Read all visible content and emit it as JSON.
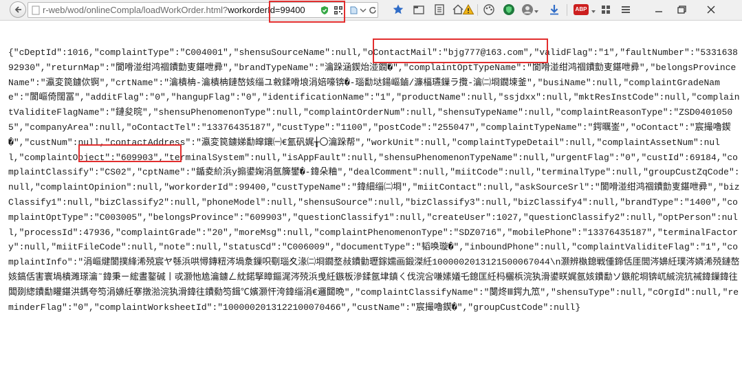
{
  "browser": {
    "url_prefix": "r-web/wod/onlineCompla/loadWorkOrder.html?",
    "url_param": "workorderId=99400",
    "icons": {
      "back": "back-arrow-icon",
      "shield": "shield-check-icon",
      "qr": "qr-code-icon",
      "page": "page-icon",
      "dropdown": "dropdown-arrow-icon",
      "reload": "reload-icon",
      "star": "bookmark-star-icon",
      "tab": "tab-icon",
      "reader": "reading-list-icon",
      "home": "home-icon",
      "alert": "warning-icon",
      "palette": "palette-icon",
      "shield_green": "green-shield-icon",
      "profile": "profile-icon",
      "download": "download-arrow-icon",
      "adblock": "adblock-icon",
      "apps": "apps-grid-icon",
      "menu": "hamburger-menu-icon",
      "minimize": "minimize-icon",
      "restore": "restore-icon",
      "close": "close-icon"
    },
    "adblock_label": "ABP",
    "accent_color": "#e22d2d"
  },
  "json_body": {
    "segments": [
      "{\"cDeptId\":1016,\"complaintType\":\"C004001\",\"shensuSourceName\":null,",
      "\"oContactMail\":\"bjg777@163.com\"",
      ",\"validFlag\":\"1\",\"faultNumber\":\"533163892930\",\"returnMap\":\"閬嗗湴绀鸿祻鐨勯叓鍖呭彛\",\"brandTypeName\":\"瀹跺涵鍥炲湴鐗�\",\"complaintOptTypeName\":\"閬嗗湴绀鸿祻鐨勯叓鍖呭彛\",\"belongsProvinceName\":\"瀛変笢鐪佽锕\",\"crtName\":\"瀹樻柟-瀹樻柟鏈嶅姟缁ユ敹鍒嗗埌涓婄嚎锛�-瑙勫垯鍚嶇鏀/濂楅瓙鏁ラ攬-瀹㈡埛鐗堜釜\",\"busiName\":null,\"complaintGradeName\":\"閬嶇倚闊冨\",\"additFlag\":\"0\",\"hangupFlag\":\"0\",\"identificationName\":\"1\",\"productName\":null,\"ssjdxx\":null,\"mktResInstCode\":null,\"complaintValiditeFlagName\":\"鏈夋晥\",\"shensuPhenomenonType\":null,\"complaintOrderNum\":null,\"shensuTypeName\":null,\"complaintReasonType\":\"ZSD04010505\",\"companyArea\":null,\"oContactTel",
      "\":\"13376435187\",",
      "\"custType\":\"1100\",\"postCode\":\"255047\",\"complaintTypeName\":\"鍔曞崟\",\"oContact\":\"宸撮嚕鍥�\",\"custNum\":null,\"contactAddress\":\"瀛変笢鐪娣勫皡鑲㈠€氳矾娓╁〇瀹跺帮\",\"workUnit\":null,\"complaintTypeDetail\":null,\"complaintAssetNum\":null,\"complaintObject\":\"609903\",\"terminalSystem\":null,\"isAppFault\":null,\"shensuPhenomenonTypeName\":null,\"urgentFlag\":\"0\",\"custId\":69184,\"complaintClassify\":\"CS02\",\"cptName\":\"鍎夌紒浜у搧鍙婅涓氬簲鐢�-鍏朵粬\",\"dealComment\":null,\"miitCode\":null,\"terminalType\":null,\"groupCustZqCode\":null,\"complaintOpinion\":null,\"workorderId\":99400,\"custTypeName\":\"鍏細缁㈡埛\",\"miitContact\":null,\"askSourceSrl\":\"閬嗗湴绀鸿祻鐨勯叓鍖呭彛\",\"bizClassify1\":null,\"bizClassify2\":null,\"phoneModel\":null,\"shensuSource\":null,\"bizClassify3\":null,\"bizClassify4\":null,\"brandType\":\"1400\",\"complaintOptType\":\"C003005\",\"belongsProvince\":\"609903\",\"questionClassify1\":null,\"createUser\":1027,\"questionClassify2\":null,\"optPerson\":null,\"processId\":47936,\"complaintGrade\":\"20\",\"moreMsg\":null,\"complaintPhenomenonType\":\"SDZ0716\",\"mobilePhone\":\"13376435187\",\"terminalFactory\":null,\"miitFileCode\":null,\"note\":null,\"statusCd\":\"C006009\",\"documentType\":\"韬唤璇�\",\"inboundPhone\":null,\"complaintValiditeFlag\":\"1\",\"complaintInfo\":\"涓嶇煡閬撲綘浠殑宸ヤ綔浜哄憳鏄粈涔堝洜鏁呮劅瑙夊湪㈡埛鐗堥敊鐨勭瓑鎵嬬画鍛滐紝1000002013121500067044\\n灏辨槸鎴戦偅鍗佸厓閭涔嬶紝璞涔嫾浠殑鏈嶅姟鎬佸害寰堝樻濉瑹瀹˜鍏秉ㄧ綋晝鐜碱丨戓灏忚尯瀹鐪ㄥ紞鍩掔瞕鏂浘涔殑浜曵紝鏃板滲鍒氬垏鎮ㄑ伐浣吢嗛嫊嬟乇鎴匡紝杩欐梹浣犱滑鍙眹娓氬姟鐨勫ソ鏃舵埛锛屼絾浣犺祴鍏鏁鍏往闆剟緫鐨勫矔鍖洪鎷夸笉涓嬶紝搴撴湁浣犱滑鍏往鐨勬笉鍓℃嬪灏忓洿鍏缁涓€邏閮晩\",\"complaintClassifyName\":\"闅炵Ⅲ鍔九笟\",\"shensuType\":null,\"cOrgId\":null,\"reminderFlag\":\"0\",\"complaintWorksheetId\":\"1000002013122100070466\",\"custName\":\"宸撮嚕鍥�\",\"groupCustCode\":null}"
    ]
  }
}
